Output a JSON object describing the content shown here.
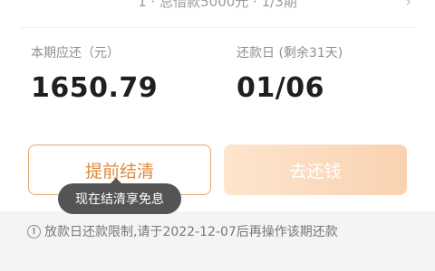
{
  "top": {
    "summary_text": "1 · 总借款5000元 · 1/3期",
    "chevron_icon": "chevron-right-icon"
  },
  "current_period": {
    "label": "本期应还（元）",
    "amount": "1650.79"
  },
  "due_date": {
    "label": "还款日 (剩余31天)",
    "date": "01/06"
  },
  "actions": {
    "prepay_label": "提前结清",
    "repay_label": "去还钱"
  },
  "tooltip": {
    "text": "现在结清享免息"
  },
  "notice": {
    "icon": "info-icon",
    "text": "放款日还款限制,请于2022-12-07后再操作该期还款"
  },
  "colors": {
    "accent": "#e08a3c",
    "button_fill_start": "#fde5cd",
    "button_fill_end": "#f9d2b1",
    "tooltip_bg": "#545454"
  }
}
